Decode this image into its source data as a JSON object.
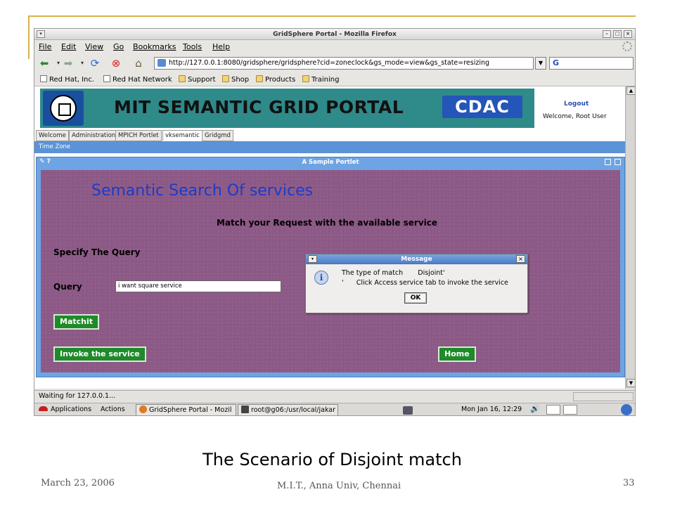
{
  "browser": {
    "window_title": "GridSphere Portal - Mozilla Firefox",
    "menu": [
      "File",
      "Edit",
      "View",
      "Go",
      "Bookmarks",
      "Tools",
      "Help"
    ],
    "url": "http://127.0.0.1:8080/gridsphere/gridsphere?cid=zoneclock&gs_mode=view&gs_state=resizing",
    "search_engine_glyph": "G",
    "bookmarks": [
      "Red Hat, Inc.",
      "Red Hat Network",
      "Support",
      "Shop",
      "Products",
      "Training"
    ],
    "status_text": "Waiting for 127.0.0.1..."
  },
  "portal": {
    "title": "MIT SEMANTIC GRID PORTAL",
    "partner_logo_text": "CDAC",
    "logout_label": "Logout",
    "welcome_text": "Welcome, Root User",
    "tabs": [
      "Welcome",
      "Administration",
      "MPICH Portlet",
      "vksemantic",
      "Gridgmd"
    ],
    "active_tab": "vksemantic",
    "subnav": "Time Zone",
    "portlet_title": "A Sample Portlet",
    "portlet_icons": "✎ ?"
  },
  "form": {
    "heading": "Semantic Search Of services",
    "subheading": "Match your Request with the available service",
    "specify_label": "Specify The Query",
    "query_label": "Query",
    "query_value": "i want  square service",
    "matchit_label": "Matchit",
    "invoke_label": "Invoke the service",
    "home_label": "Home"
  },
  "dialog": {
    "title": "Message",
    "line1": "The type of match       Disjoint'",
    "line2": "'      Click Access service tab to invoke the service",
    "ok_label": "OK"
  },
  "taskbar": {
    "applications": "Applications",
    "actions": "Actions",
    "window1": "GridSphere Portal - Mozil",
    "window2": "root@g06:/usr/local/jakar",
    "clock": "Mon Jan 16, 12:29"
  },
  "slide": {
    "caption": "The Scenario of Disjoint match",
    "date": "March 23, 2006",
    "institution": "M.I.T., Anna Univ, Chennai",
    "page_number": "33"
  },
  "colors": {
    "banner": "#2f8a8a",
    "portlet_frame": "#6ea4e3",
    "content_purple": "#8d5a87",
    "heading_blue": "#1a3cc8",
    "button_green": "#1f8a2a",
    "slide_accent": "#d9b34a"
  }
}
